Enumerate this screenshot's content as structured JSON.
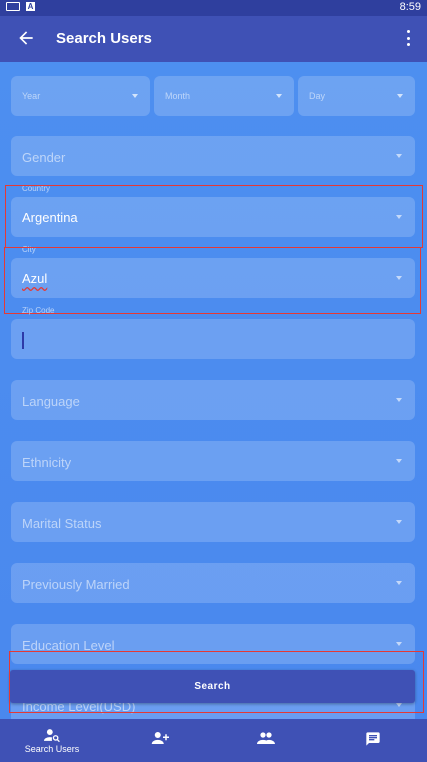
{
  "status_bar": {
    "time": "8:59",
    "notification_icons": [
      "keyboard-icon",
      "a-icon"
    ]
  },
  "app_bar": {
    "title": "Search Users",
    "back_icon": "arrow-left-icon",
    "menu_icon": "more-vert-icon"
  },
  "date_fields": [
    {
      "label": "Year"
    },
    {
      "label": "Month"
    },
    {
      "label": "Day"
    }
  ],
  "form": {
    "gender": {
      "label": "Gender"
    },
    "country": {
      "label": "Country",
      "value": "Argentina"
    },
    "city": {
      "label": "City",
      "value": "Azul"
    },
    "zip": {
      "label": "Zip Code",
      "value": ""
    },
    "language": {
      "label": "Language"
    },
    "ethnicity": {
      "label": "Ethnicity"
    },
    "marital_status": {
      "label": "Marital Status"
    },
    "previously_married": {
      "label": "Previously Married"
    },
    "education_level": {
      "label": "Education Level"
    },
    "income_level": {
      "label": "Income Level(USD)"
    }
  },
  "search_button": {
    "label": "Search"
  },
  "bottom_nav": [
    {
      "label": "Search Users",
      "icon": "person-search-icon"
    },
    {
      "label": "",
      "icon": "person-add-icon"
    },
    {
      "label": "",
      "icon": "people-icon"
    },
    {
      "label": "",
      "icon": "message-icon"
    }
  ],
  "colors": {
    "primary": "#3f51b5",
    "background": "#4d8ff0",
    "highlight": "#e53935"
  }
}
